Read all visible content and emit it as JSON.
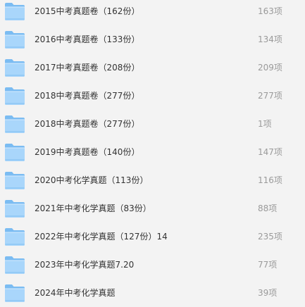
{
  "folder_list": {
    "items": [
      {
        "name": "2015中考真题卷（162份）",
        "count": "163项",
        "icon": "folder-icon"
      },
      {
        "name": "2016中考真题卷（133份）",
        "count": "134项",
        "icon": "folder-icon"
      },
      {
        "name": "2017中考真题卷（208份）",
        "count": "209项",
        "icon": "folder-icon"
      },
      {
        "name": "2018中考真题卷（277份）",
        "count": "277项",
        "icon": "folder-icon"
      },
      {
        "name": "2018中考真题卷（277份）",
        "count": "1项",
        "icon": "folder-icon"
      },
      {
        "name": "2019中考真题卷（140份）",
        "count": "147项",
        "icon": "folder-icon"
      },
      {
        "name": "2020中考化学真题（113份）",
        "count": "116项",
        "icon": "folder-icon"
      },
      {
        "name": "2021年中考化学真题（83份）",
        "count": "88项",
        "icon": "folder-icon"
      },
      {
        "name": "2022年中考化学真题（127份）14",
        "count": "235项",
        "icon": "folder-icon"
      },
      {
        "name": "2023年中考化学真题7.20",
        "count": "77项",
        "icon": "folder-icon"
      },
      {
        "name": "2024年中考化学真题",
        "count": "39项",
        "icon": "folder-icon"
      }
    ]
  },
  "colors": {
    "background": "#f3f3f3",
    "folder_back": "#8cc6f5",
    "folder_front": "#a9d6fb",
    "folder_edge": "#5aa6e6",
    "name_text": "#333333",
    "count_text": "#9a9a9a"
  }
}
